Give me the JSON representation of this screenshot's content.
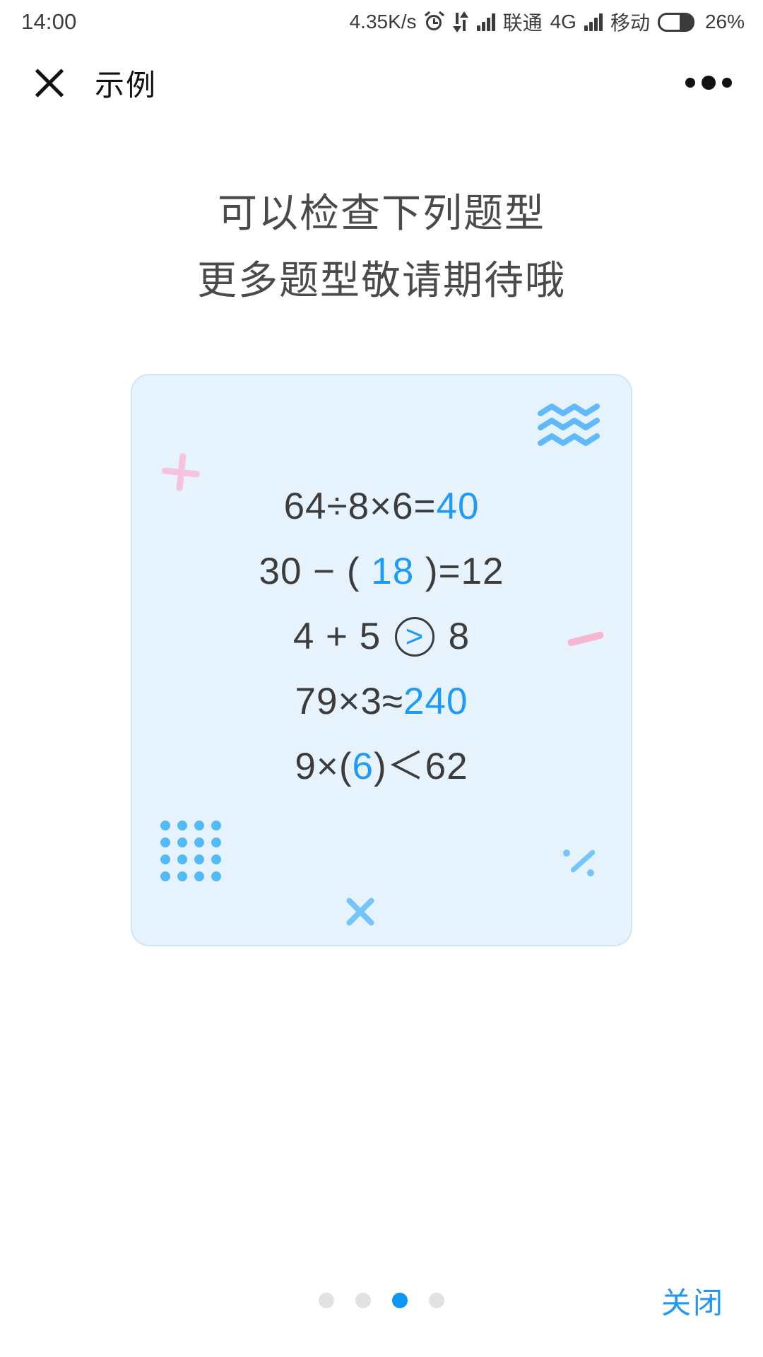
{
  "statusbar": {
    "time": "14:00",
    "network_speed": "4.35K/s",
    "alarm_icon": "alarm-clock-icon",
    "data_icon": "data-transfer-icon",
    "carrier_1": "联通",
    "network_type": "4G",
    "carrier_2": "移动",
    "battery_percent": "26%"
  },
  "navbar": {
    "close_icon": "close-x-icon",
    "title": "示例",
    "more_icon": "more-dots-icon"
  },
  "headings": {
    "line1": "可以检查下列题型",
    "line2": "更多题型敬请期待哦"
  },
  "card": {
    "background_color": "#e6f2fc",
    "border_color": "#cde6fa",
    "answer_color": "#1d9bf8",
    "text_color": "#3c3c3c",
    "equations": [
      {
        "prefix": "64÷8×6=",
        "answer": "40",
        "suffix": ""
      },
      {
        "prefix": "30 − ( ",
        "answer": "18",
        "suffix": " )=12"
      },
      {
        "prefix": "4 + 5 ",
        "answer": ">",
        "suffix": " 8",
        "circled": true
      },
      {
        "prefix": "79×3≈",
        "answer": "240",
        "suffix": ""
      },
      {
        "prefix": "9×(",
        "answer": "6",
        "suffix": ")＜62"
      }
    ],
    "decorations": [
      "waves-icon",
      "plus-icon",
      "dash-icon",
      "dot-grid-icon",
      "multiply-icon",
      "divide-icon"
    ]
  },
  "footer": {
    "pager_total": 4,
    "pager_active_index": 3,
    "close_label": "关闭",
    "close_color": "#2196f3"
  }
}
